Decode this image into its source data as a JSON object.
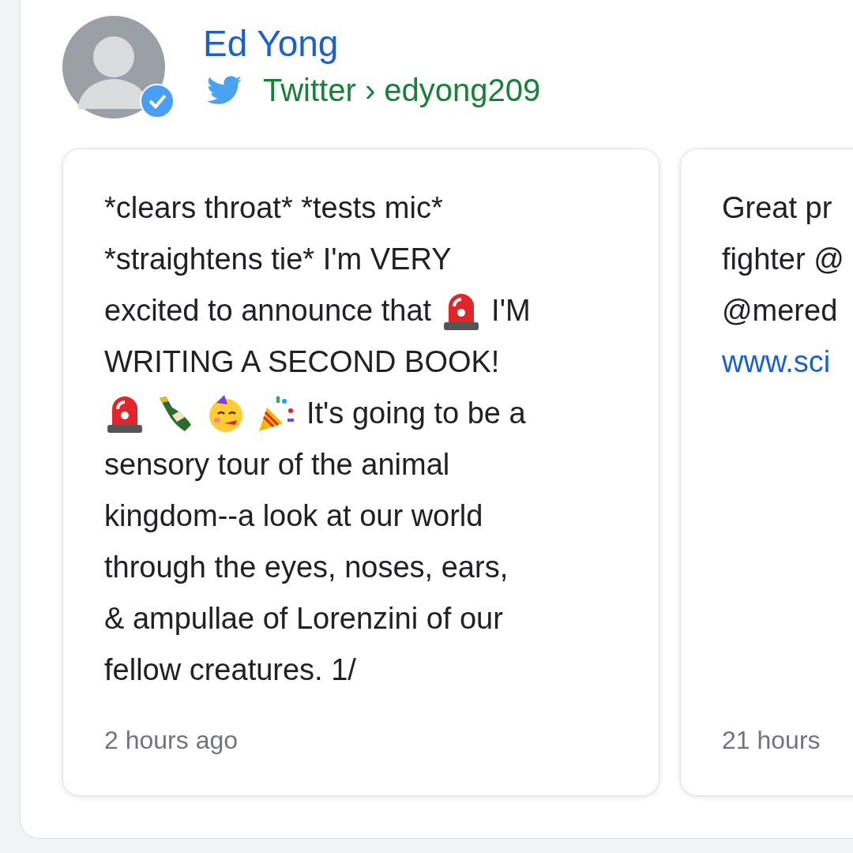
{
  "profile": {
    "name": "Ed Yong",
    "source": "Twitter",
    "separator": "›",
    "handle": "edyong209",
    "verified": true
  },
  "tweets": [
    {
      "lines": [
        [
          {
            "kind": "text",
            "text": "*clears throat* *tests mic*"
          }
        ],
        [
          {
            "kind": "text",
            "text": "*straightens tie* I'm VERY"
          }
        ],
        [
          {
            "kind": "text",
            "text": "excited to announce that"
          },
          {
            "kind": "siren"
          },
          {
            "kind": "text",
            "text": "I'M"
          }
        ],
        [
          {
            "kind": "text",
            "text": "WRITING A SECOND BOOK!"
          }
        ],
        [
          {
            "kind": "siren"
          },
          {
            "kind": "bottle"
          },
          {
            "kind": "party-face"
          },
          {
            "kind": "popper"
          },
          {
            "kind": "text",
            "text": "It's going to be a"
          }
        ],
        [
          {
            "kind": "text",
            "text": "sensory tour of the animal"
          }
        ],
        [
          {
            "kind": "text",
            "text": "kingdom--a look at our world"
          }
        ],
        [
          {
            "kind": "text",
            "text": "through the eyes, noses, ears,"
          }
        ],
        [
          {
            "kind": "text",
            "text": "& ampullae of Lorenzini of our"
          }
        ],
        [
          {
            "kind": "text",
            "text": "fellow creatures. 1/"
          }
        ]
      ],
      "time": "2 hours ago"
    },
    {
      "lines": [
        [
          {
            "kind": "text",
            "text": "Great pr"
          }
        ],
        [
          {
            "kind": "text",
            "text": "fighter @"
          }
        ],
        [
          {
            "kind": "text",
            "text": "@mered"
          }
        ],
        [
          {
            "kind": "link",
            "text": "www.sci"
          }
        ]
      ],
      "time": "21 hours"
    }
  ]
}
